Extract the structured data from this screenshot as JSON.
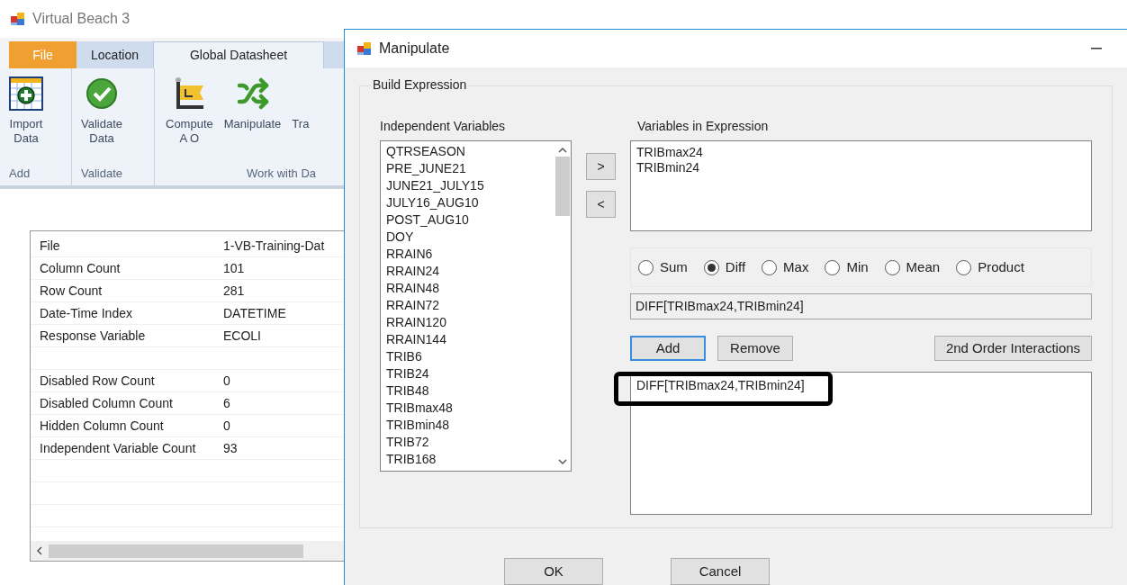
{
  "app": {
    "title": "Virtual Beach 3"
  },
  "file_menu": "File",
  "tabs": [
    {
      "label": "Location",
      "selected": false
    },
    {
      "label": "Global Datasheet",
      "selected": true
    }
  ],
  "ribbon": {
    "buttons": [
      {
        "label": "Import Data"
      },
      {
        "label": "Validate Data"
      },
      {
        "label": "Compute A O"
      },
      {
        "label": "Manipulate"
      },
      {
        "label": "Tra"
      }
    ],
    "groups": [
      {
        "label": "Add"
      },
      {
        "label": "Validate"
      },
      {
        "label": "Work with Da"
      }
    ]
  },
  "datasheet_info": {
    "rows": [
      {
        "kind": "entry",
        "name": "File",
        "value": "1-VB-Training-Dat"
      },
      {
        "kind": "entry",
        "name": "Column Count",
        "value": "101"
      },
      {
        "kind": "entry",
        "name": "Row Count",
        "value": "281"
      },
      {
        "kind": "entry",
        "name": "Date-Time Index",
        "value": "DATETIME"
      },
      {
        "kind": "entry",
        "name": "Response Variable",
        "value": "ECOLI"
      },
      {
        "kind": "blank"
      },
      {
        "kind": "entry",
        "name": "Disabled Row Count",
        "value": "0"
      },
      {
        "kind": "entry",
        "name": "Disabled Column Count",
        "value": "6"
      },
      {
        "kind": "entry",
        "name": "Hidden Column Count",
        "value": "0"
      },
      {
        "kind": "entry",
        "name": "Independent Variable Count",
        "value": "93"
      },
      {
        "kind": "blank"
      },
      {
        "kind": "blank"
      },
      {
        "kind": "blank"
      }
    ]
  },
  "dialog": {
    "title": "Manipulate",
    "group_label": "Build Expression",
    "independent_label": "Independent Variables",
    "independent_variables": [
      "QTRSEASON",
      "PRE_JUNE21",
      "JUNE21_JULY15",
      "JULY16_AUG10",
      "POST_AUG10",
      "DOY",
      "RRAIN6",
      "RRAIN24",
      "RRAIN48",
      "RRAIN72",
      "RRAIN120",
      "RRAIN144",
      "TRIB6",
      "TRIB24",
      "TRIB48",
      "TRIBmax48",
      "TRIBmin48",
      "TRIB72",
      "TRIB168"
    ],
    "move_buttons": [
      ">",
      "<"
    ],
    "expression_label": "Variables in Expression",
    "expression_variables": [
      "TRIBmax24",
      "TRIBmin24"
    ],
    "operations": [
      {
        "label": "Sum",
        "selected": false
      },
      {
        "label": "Diff",
        "selected": true
      },
      {
        "label": "Max",
        "selected": false
      },
      {
        "label": "Min",
        "selected": false
      },
      {
        "label": "Mean",
        "selected": false
      },
      {
        "label": "Product",
        "selected": false
      }
    ],
    "expression": "DIFF[TRIBmax24,TRIBmin24]",
    "actions": [
      {
        "label": "Add",
        "focused": true
      },
      {
        "label": "Remove",
        "focused": false
      }
    ],
    "interactions_button": "2nd Order Interactions",
    "results": [
      {
        "text": "DIFF[TRIBmax24,TRIBmin24]",
        "highlighted": true
      }
    ],
    "footer_buttons": [
      "OK",
      "Cancel"
    ]
  }
}
